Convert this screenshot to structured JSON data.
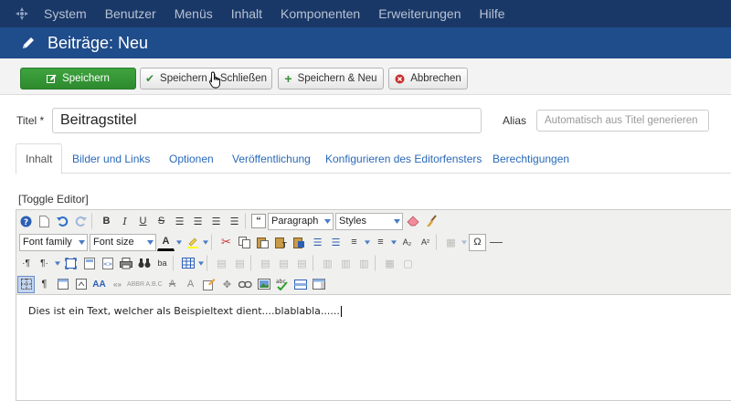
{
  "topbar": {
    "menu": [
      "System",
      "Benutzer",
      "Menüs",
      "Inhalt",
      "Komponenten",
      "Erweiterungen",
      "Hilfe"
    ]
  },
  "titlebar": {
    "title": "Beiträge: Neu"
  },
  "actions": {
    "save": "Speichern",
    "save_close": "Speichern & Schließen",
    "save_new": "Speichern & Neu",
    "cancel": "Abbrechen"
  },
  "form": {
    "title_label": "Titel *",
    "title_value": "Beitragstitel",
    "alias_label": "Alias",
    "alias_placeholder": "Automatisch aus Titel generieren"
  },
  "tabs": [
    "Inhalt",
    "Bilder und Links",
    "Optionen",
    "Veröffentlichung",
    "Konfigurieren des Editorfensters",
    "Berechtigungen"
  ],
  "editor": {
    "toggle": "[Toggle Editor]",
    "format_select": "Paragraph",
    "styles_select": "Styles",
    "font_family_select": "Font family",
    "font_size_select": "Font size",
    "content": "Dies ist ein Text, welcher als Beispieltext dient....blablabla......"
  },
  "colors": {
    "topbar": "#1a3867",
    "titlebar": "#1f4c8b",
    "save_green": "#2d8a2d",
    "link_blue": "#2a69b8"
  }
}
